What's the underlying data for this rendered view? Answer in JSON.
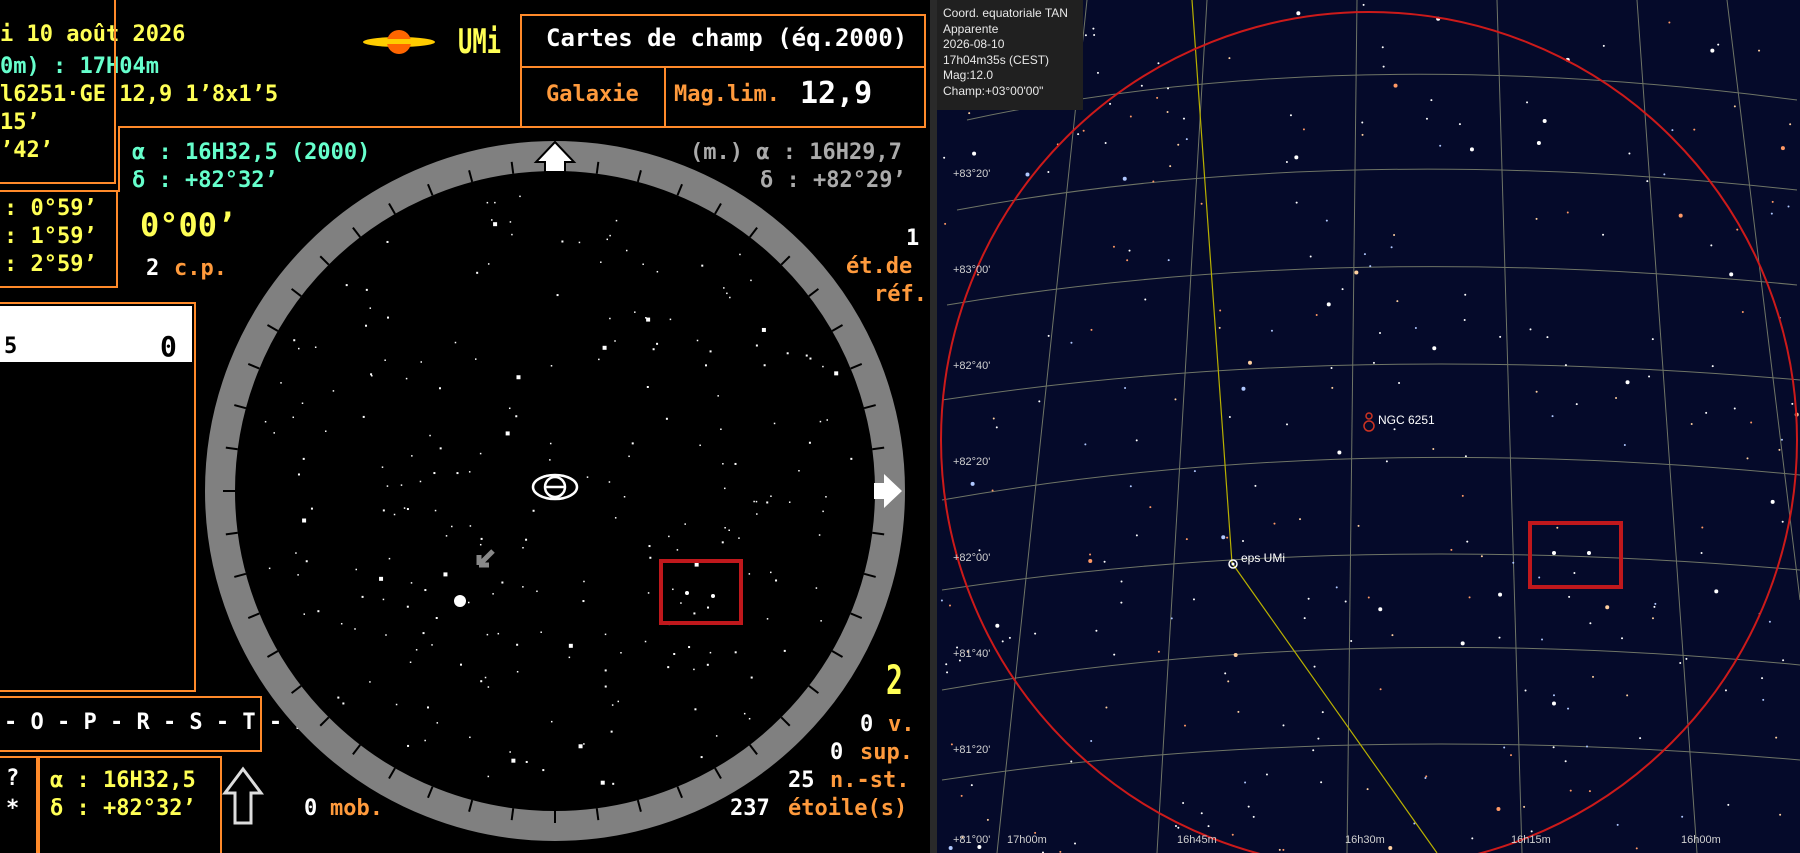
{
  "left_panel": {
    "date_line": "i 10 août 2026",
    "time_line": "0m) : 17H04m",
    "object_line": "l6251·GE 12,9 1’8x1’5",
    "size_line1": "15’",
    "size_line2": "’42’",
    "constellation": "UMi",
    "title": "Cartes de champ (éq.2000)",
    "type_label": "Galaxie",
    "maglim_label": "Mag.lim.",
    "maglim_value": "12,9",
    "alpha_2000": "α : 16H32,5 (2000)",
    "delta_2000": "δ : +82°32’",
    "alpha_m": "(m.) α : 16H29,7",
    "delta_m": "δ : +82°29’",
    "fields": [
      ": 0°59’",
      ": 1°59’",
      ": 2°59’"
    ],
    "offset": "0°00’",
    "cp_count": "2",
    "cp_label": "c.p.",
    "ref_count": "1",
    "ref_label1": "ét.de",
    "ref_label2": "réf.",
    "list_left": "5",
    "list_right": "0",
    "letters": "- O - P - R - S - T - Z",
    "q_mark": "?",
    "star_mark": "*",
    "alpha_bottom": "α : 16H32,5",
    "delta_bottom": "δ : +82°32’",
    "mob_count": "0",
    "mob_label": "mob.",
    "big_num": "2",
    "v_count": "0",
    "v_label": "v.",
    "sup_count": "0",
    "sup_label": "sup.",
    "nst_count": "25",
    "nst_label": "n.-st.",
    "star_count": "237",
    "star_label": "étoile(s)"
  },
  "right_panel": {
    "info": [
      "Coord. equatoriale TAN",
      "Apparente",
      "2026-08-10",
      "17h04m35s (CEST)",
      "Mag:12.0",
      "Champ:+03°00'00\""
    ],
    "dec_labels": [
      "+83°20'",
      "+83°00'",
      "+82°40'",
      "+82°20'",
      "+82°00'",
      "+81°40'",
      "+81°20'",
      "+81°00'"
    ],
    "ra_labels": [
      "17h00m",
      "16h45m",
      "16h30m",
      "16h15m",
      "16h00m"
    ],
    "ngc_label": "NGC 6251",
    "star_label": "eps UMi"
  },
  "colors": {
    "orange": "#ff8a2a",
    "yellow": "#ffff55",
    "cyan": "#66ffcc",
    "chart_bg": "#050a2a",
    "circle_red": "#cc1a1a"
  }
}
